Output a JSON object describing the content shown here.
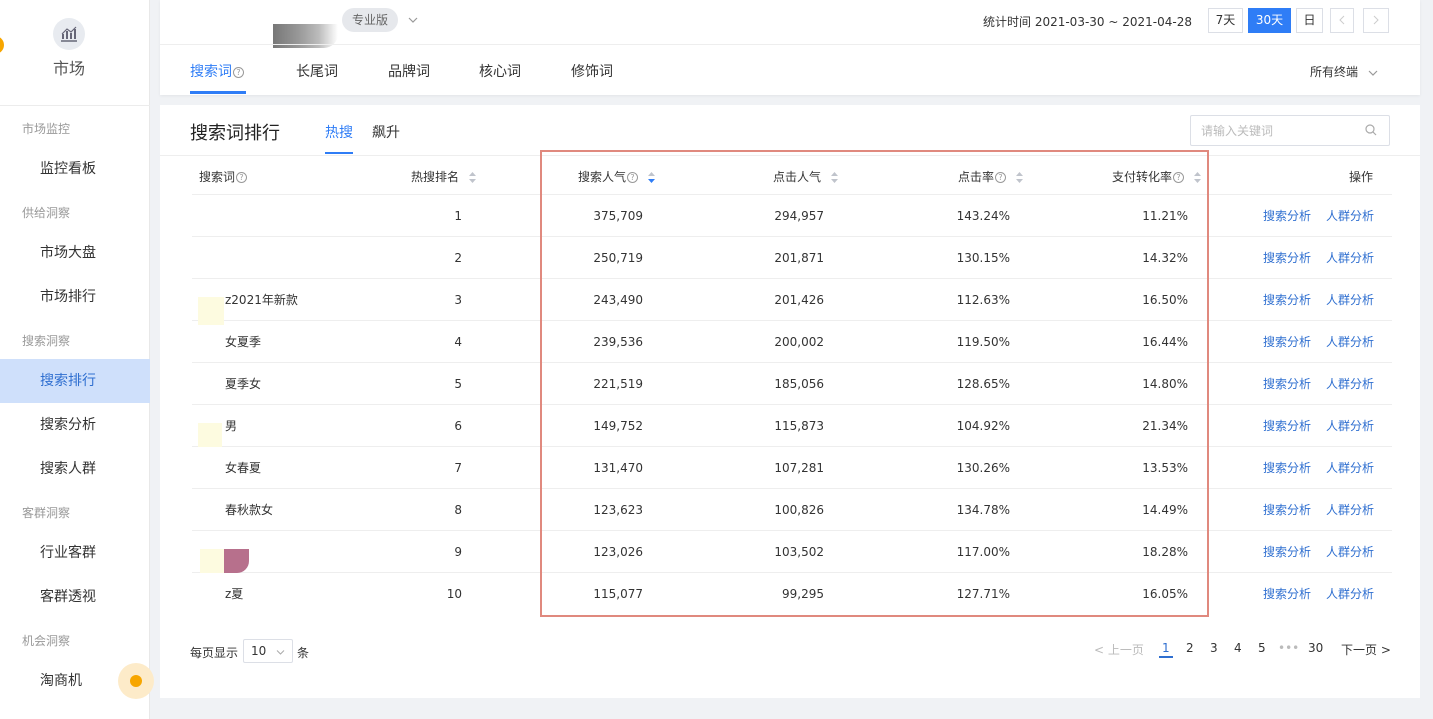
{
  "sidebar": {
    "market_label": "市场",
    "groups": [
      "市场监控",
      "供给洞察",
      "搜索洞察",
      "客群洞察",
      "机会洞察"
    ],
    "items": [
      "监控看板",
      "市场大盘",
      "市场排行",
      "搜索排行",
      "搜索分析",
      "搜索人群",
      "行业客群",
      "客群透视",
      "淘商机"
    ],
    "active_item": "搜索排行"
  },
  "top": {
    "badge": "专业版",
    "stat_time": "统计时间 2021-03-30 ~ 2021-04-28",
    "periods": [
      "7天",
      "30天",
      "日"
    ],
    "active_period": "30天",
    "tabs": [
      "搜索词",
      "长尾词",
      "品牌词",
      "核心词",
      "修饰词"
    ],
    "active_tab": "搜索词",
    "terminal": "所有终端"
  },
  "panel": {
    "title": "搜索词排行",
    "subtabs": [
      "热搜",
      "飙升"
    ],
    "active_subtab": "热搜",
    "search_placeholder": "请输入关键词"
  },
  "table": {
    "headers": [
      "搜索词",
      "热搜排名",
      "搜索人气",
      "点击人气",
      "点击率",
      "支付转化率",
      "操作"
    ],
    "rows": [
      {
        "term": "",
        "rank": "1",
        "search": "375,709",
        "click": "294,957",
        "ctr": "143.24%",
        "conv": "11.21%"
      },
      {
        "term": "",
        "rank": "2",
        "search": "250,719",
        "click": "201,871",
        "ctr": "130.15%",
        "conv": "14.32%"
      },
      {
        "term": "z2021年新款",
        "rank": "3",
        "search": "243,490",
        "click": "201,426",
        "ctr": "112.63%",
        "conv": "16.50%"
      },
      {
        "term": "女夏季",
        "rank": "4",
        "search": "239,536",
        "click": "200,002",
        "ctr": "119.50%",
        "conv": "16.44%"
      },
      {
        "term": "夏季女",
        "rank": "5",
        "search": "221,519",
        "click": "185,056",
        "ctr": "128.65%",
        "conv": "14.80%"
      },
      {
        "term": "男",
        "rank": "6",
        "search": "149,752",
        "click": "115,873",
        "ctr": "104.92%",
        "conv": "21.34%"
      },
      {
        "term": "女春夏",
        "rank": "7",
        "search": "131,470",
        "click": "107,281",
        "ctr": "130.26%",
        "conv": "13.53%"
      },
      {
        "term": "春秋款女",
        "rank": "8",
        "search": "123,623",
        "click": "100,826",
        "ctr": "134.78%",
        "conv": "14.49%"
      },
      {
        "term": "",
        "rank": "9",
        "search": "123,026",
        "click": "103,502",
        "ctr": "117.00%",
        "conv": "18.28%"
      },
      {
        "term": "z夏",
        "rank": "10",
        "search": "115,077",
        "click": "99,295",
        "ctr": "127.71%",
        "conv": "16.05%"
      }
    ],
    "action_search": "搜索分析",
    "action_crowd": "人群分析"
  },
  "pagination": {
    "per_page_label": "每页显示",
    "per_page_value": "10",
    "per_page_unit": "条",
    "prev": "< 上一页",
    "pages": [
      "1",
      "2",
      "3",
      "4",
      "5"
    ],
    "ellipsis": "•••",
    "last": "30",
    "next": "下一页 >"
  },
  "colors": {
    "accent": "#2f7df6",
    "highlight_border": "#e0897e",
    "active_sidebar_bg": "#cfe0fb"
  }
}
